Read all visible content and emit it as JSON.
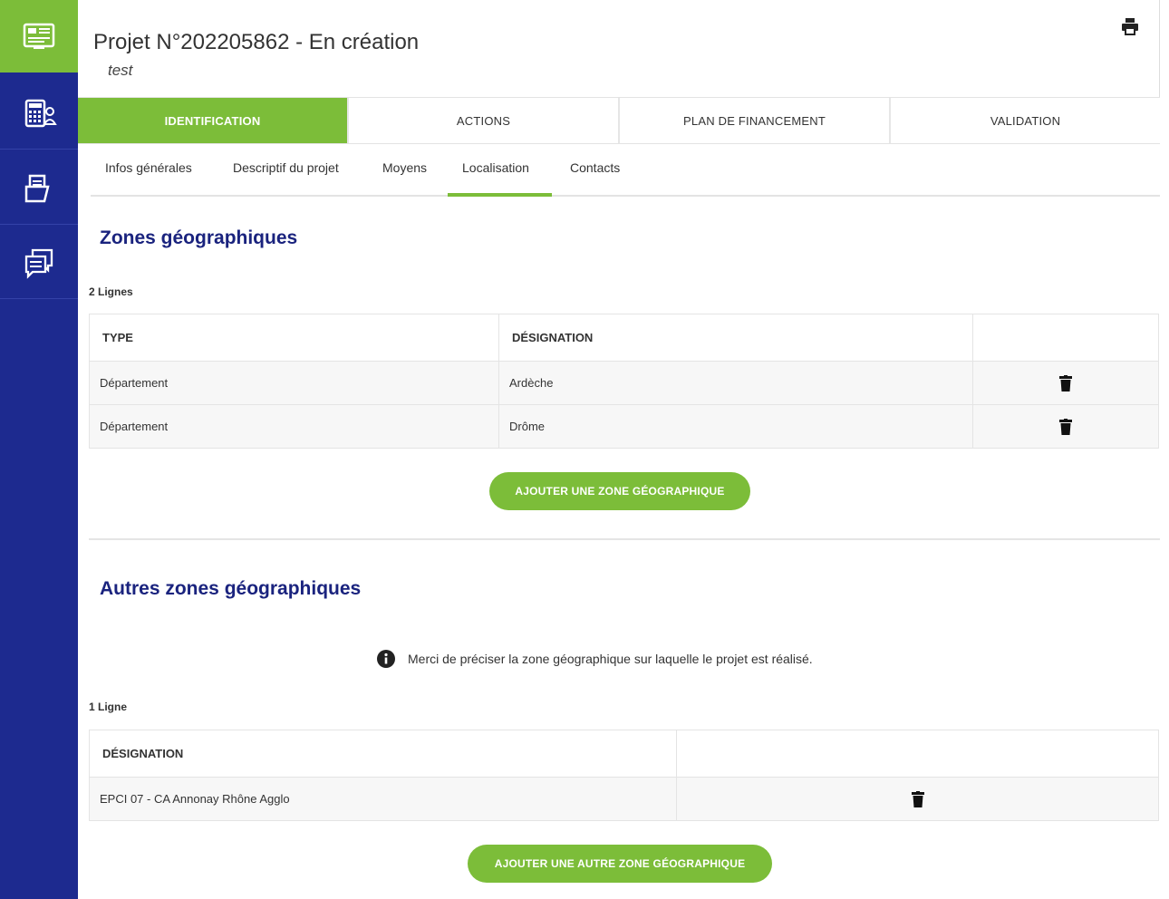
{
  "sidebar": {
    "items": [
      {
        "icon": "dashboard-card-icon",
        "active": true
      },
      {
        "icon": "calculator-user-icon",
        "active": false
      },
      {
        "icon": "folder-documents-icon",
        "active": false
      },
      {
        "icon": "chat-messages-icon",
        "active": false
      }
    ]
  },
  "header": {
    "title": "Projet N°202205862 - En création",
    "subtitle": "test",
    "print_icon": "print-icon"
  },
  "tabs": [
    {
      "label": "IDENTIFICATION",
      "active": true
    },
    {
      "label": "ACTIONS",
      "active": false
    },
    {
      "label": "PLAN DE FINANCEMENT",
      "active": false
    },
    {
      "label": "VALIDATION",
      "active": false
    }
  ],
  "subtabs": [
    {
      "label": "Infos générales"
    },
    {
      "label": "Descriptif du projet"
    },
    {
      "label": "Moyens"
    },
    {
      "label": "Localisation",
      "active": true
    },
    {
      "label": "Contacts"
    }
  ],
  "zones": {
    "title": "Zones géographiques",
    "count": "2 Lignes",
    "headers": [
      "TYPE",
      "DÉSIGNATION",
      ""
    ],
    "rows": [
      {
        "type": "Département",
        "designation": "Ardèche"
      },
      {
        "type": "Département",
        "designation": "Drôme"
      }
    ],
    "add_button": "AJOUTER UNE ZONE GÉOGRAPHIQUE"
  },
  "autres": {
    "title": "Autres zones géographiques",
    "info": "Merci de préciser la zone géographique sur laquelle le projet est réalisé.",
    "count": "1 Ligne",
    "headers": [
      "DÉSIGNATION",
      ""
    ],
    "rows": [
      {
        "designation": "EPCI 07 - CA Annonay Rhône Agglo"
      }
    ],
    "add_button": "AJOUTER UNE AUTRE ZONE GÉOGRAPHIQUE"
  },
  "colors": {
    "sidebar": "#1d2a8f",
    "accent_green": "#7cbd39",
    "title_blue": "#1a237e"
  }
}
